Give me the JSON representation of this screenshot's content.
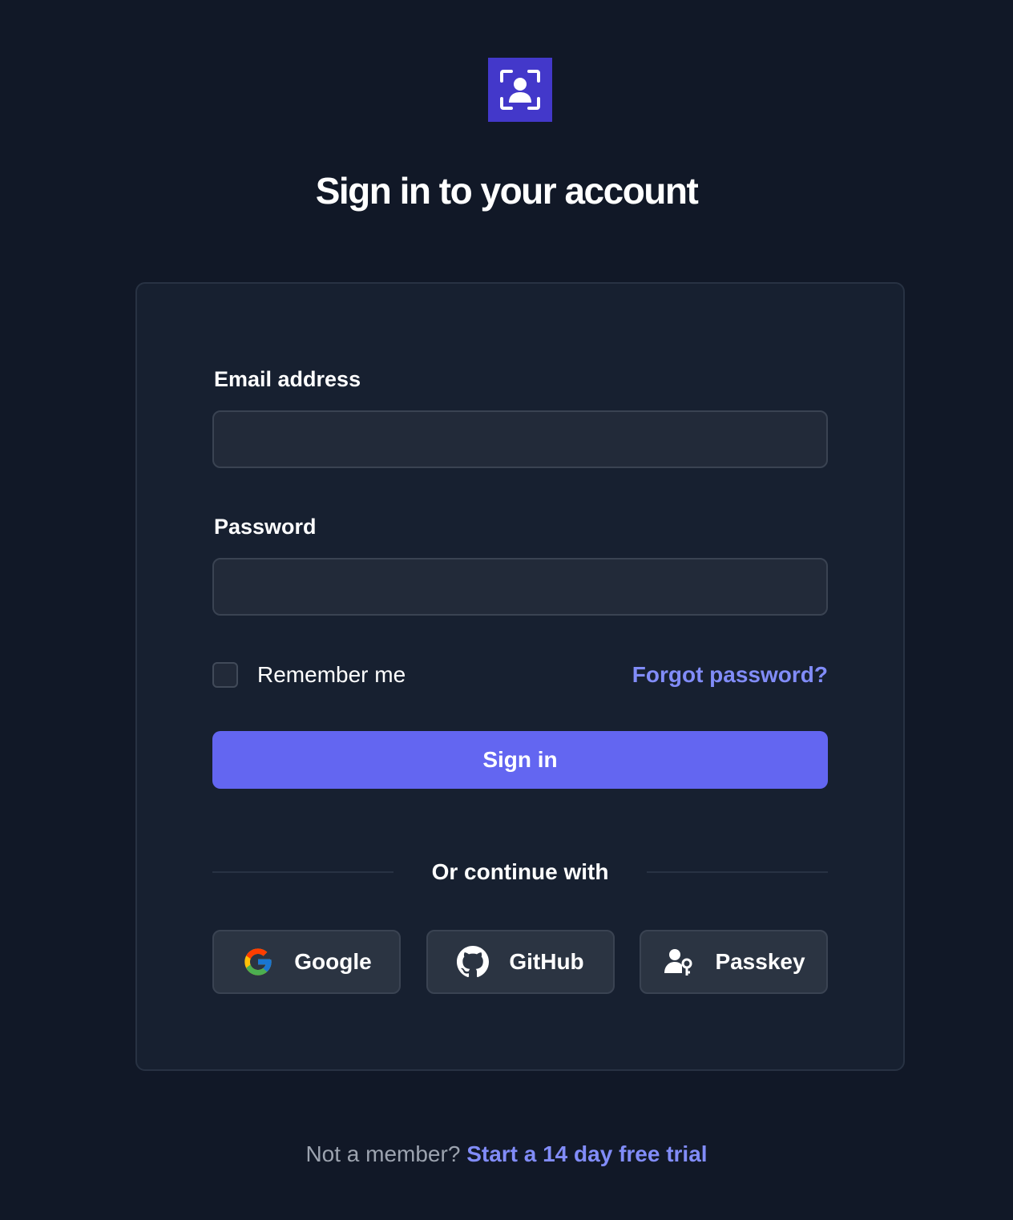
{
  "header": {
    "logo_icon": "user-scan-icon",
    "title": "Sign in to your account"
  },
  "form": {
    "email_label": "Email address",
    "email_value": "",
    "password_label": "Password",
    "password_value": "",
    "remember_label": "Remember me",
    "remember_checked": false,
    "forgot_label": "Forgot password?",
    "submit_label": "Sign in"
  },
  "divider": {
    "text": "Or continue with"
  },
  "providers": [
    {
      "label": "Google",
      "icon": "google-icon"
    },
    {
      "label": "GitHub",
      "icon": "github-icon"
    },
    {
      "label": "Passkey",
      "icon": "passkey-icon"
    }
  ],
  "footer": {
    "prompt": "Not a member?",
    "link_label": "Start a 14 day free trial"
  },
  "colors": {
    "background": "#111827",
    "card": "#172030",
    "accent": "#6366f1",
    "link": "#818cf8",
    "logo": "#4338ca"
  }
}
